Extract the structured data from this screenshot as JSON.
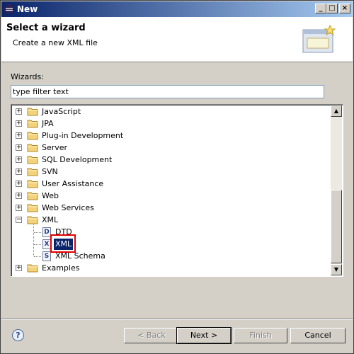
{
  "window": {
    "title": "New"
  },
  "title_buttons": {
    "minimize": "_",
    "maximize": "□",
    "close": "×"
  },
  "header": {
    "title": "Select a wizard",
    "description": "Create a new XML file"
  },
  "wizards": {
    "label": "Wizards:",
    "filter_placeholder": "type filter text"
  },
  "tree": {
    "items": [
      {
        "label": "JavaScript",
        "expanded": false
      },
      {
        "label": "JPA",
        "expanded": false
      },
      {
        "label": "Plug-in Development",
        "expanded": false
      },
      {
        "label": "Server",
        "expanded": false
      },
      {
        "label": "SQL Development",
        "expanded": false
      },
      {
        "label": "SVN",
        "expanded": false
      },
      {
        "label": "User Assistance",
        "expanded": false
      },
      {
        "label": "Web",
        "expanded": false
      },
      {
        "label": "Web Services",
        "expanded": false
      },
      {
        "label": "XML",
        "expanded": true
      },
      {
        "label": "DTD",
        "icon": "D"
      },
      {
        "label": "XML",
        "icon": "X",
        "selected": true
      },
      {
        "label": "XML Schema",
        "icon": "S"
      },
      {
        "label": "Examples",
        "expanded": false
      }
    ]
  },
  "buttons": {
    "help": "?",
    "back": "< Back",
    "next": "Next >",
    "finish": "Finish",
    "cancel": "Cancel"
  },
  "colors": {
    "selection": "#0a246a",
    "highlight": "#e00000",
    "dialog": "#d4d0c8"
  }
}
